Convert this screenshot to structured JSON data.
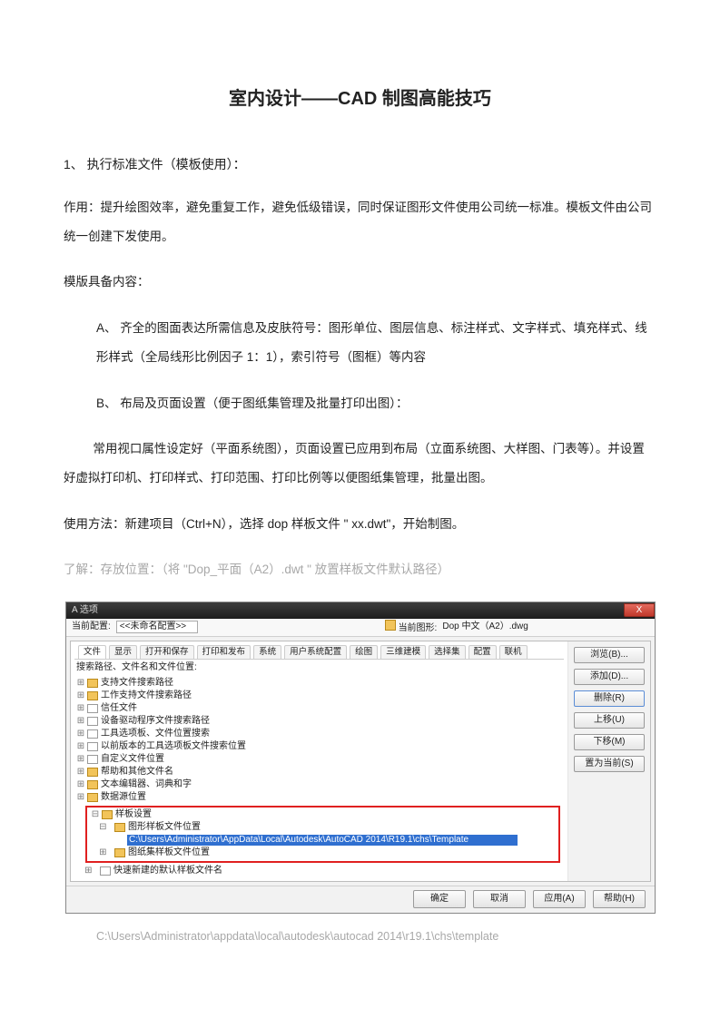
{
  "title": "室内设计——CAD 制图高能技巧",
  "section1": "1、 执行标准文件（模板使用）：",
  "p1": "作用：提升绘图效率，避免重复工作，避免低级错误，同时保证图形文件使用公司统一标准。模板文件由公司统一创建下发使用。",
  "p2": "模版具备内容：",
  "itemA": "A、 齐全的图面表达所需信息及皮肤符号：图形单位、图层信息、标注样式、文字样式、填充样式、线形样式（全局线形比例因子 1：1），索引符号（图框）等内容",
  "itemB": "B、 布局及页面设置（便于图纸集管理及批量打印出图）：",
  "p3": "常用视口属性设定好（平面系统图），页面设置已应用到布局（立面系统图、大样图、门表等）。并设置好虚拟打印机、打印样式、打印范围、打印比例等以便图纸集管理，批量出图。",
  "p4": "使用方法：新建项目（Ctrl+N），选择 dop 样板文件 \" xx.dwt\"，开始制图。",
  "p5": "了解：存放位置：（将 \"Dop_平面（A2）.dwt \" 放置样板文件默认路径）",
  "path": "C:\\Users\\Administrator\\appdata\\local\\autodesk\\autocad 2014\\r19.1\\chs\\template",
  "dialog": {
    "title": "A 选项",
    "close": "X",
    "profileLabel": "当前配置:",
    "profileValue": "<<未命名配置>>",
    "drawingLabel": "当前图形:",
    "drawingValue": "Dop 中文（A2）.dwg",
    "tabs": [
      "文件",
      "显示",
      "打开和保存",
      "打印和发布",
      "系统",
      "用户系统配置",
      "绘图",
      "三维建模",
      "选择集",
      "配置",
      "联机"
    ],
    "treeHeader": "搜索路径、文件名和文件位置:",
    "tree": [
      "支持文件搜索路径",
      "工作支持文件搜索路径",
      "信任文件",
      "设备驱动程序文件搜索路径",
      "工具选项板、文件位置搜索",
      "以前版本的工具选项板文件搜索位置",
      "自定义文件位置",
      "帮助和其他文件名",
      "文本编辑器、词典和字",
      "数据源位置"
    ],
    "selGroup": "样板设置",
    "selChild": "图形样板文件位置",
    "selPath": "C:\\Users\\Administrator\\AppData\\Local\\Autodesk\\AutoCAD 2014\\R19.1\\chs\\Template",
    "afterSel1": "图纸集样板文件位置",
    "afterSel2": "快速新建的默认样板文件名",
    "rightButtons": [
      "浏览(B)...",
      "添加(D)...",
      "删除(R)",
      "上移(U)",
      "下移(M)",
      "置为当前(S)"
    ],
    "footer": [
      "确定",
      "取消",
      "应用(A)",
      "帮助(H)"
    ]
  }
}
